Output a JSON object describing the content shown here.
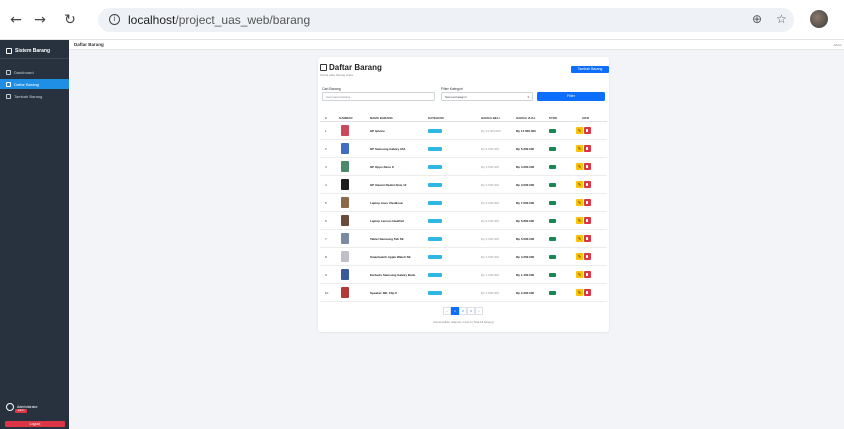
{
  "browser": {
    "url_host": "localhost",
    "url_path": "/project_uas_web/barang"
  },
  "sidebar": {
    "brand": "Sistem Barang",
    "items": [
      {
        "label": "Dashboard",
        "active": false
      },
      {
        "label": "Daftar Barang",
        "active": true
      },
      {
        "label": "Tambah Barang",
        "active": false
      }
    ],
    "user_name": "Administrator",
    "user_role": "admin",
    "logout_label": "Logout"
  },
  "topbar": {
    "title": "Daftar Barang",
    "right_text": "Admin"
  },
  "page": {
    "title": "Daftar Barang",
    "subtitle": "Kelola data barang Anda",
    "add_button": "Tambah Barang"
  },
  "filters": {
    "search_label": "Cari Barang",
    "search_placeholder": "Cari nama barang...",
    "category_label": "Filter Kategori",
    "category_value": "Semua Kategori",
    "filter_button": "Filter"
  },
  "table": {
    "columns": [
      "#",
      "GAMBAR",
      "NAMA BARANG",
      "KATEGORI",
      "HARGA BELI",
      "HARGA JUAL",
      "STOK",
      "AKSI"
    ],
    "rows": [
      {
        "no": "1",
        "name": "HP Iphone",
        "buy": "Rp 13.000.000",
        "sell": "Rp 17.000.000",
        "thumb_color": "#c94a5a"
      },
      {
        "no": "2",
        "name": "HP Samsung Galaxy A54",
        "buy": "Rp 4.500.000",
        "sell": "Rp 5.200.000",
        "thumb_color": "#3f6cc4"
      },
      {
        "no": "3",
        "name": "HP Oppo Reno 8",
        "buy": "Rp 3.500.000",
        "sell": "Rp 4.200.000",
        "thumb_color": "#4a8a6a"
      },
      {
        "no": "4",
        "name": "HP Xiaomi Redmi Note 12",
        "buy": "Rp 2.500.000",
        "sell": "Rp 3.000.000",
        "thumb_color": "#1e1e1e"
      },
      {
        "no": "5",
        "name": "Laptop Asus VivoBook",
        "buy": "Rp 6.000.000",
        "sell": "Rp 7.000.000",
        "thumb_color": "#8a6a4a"
      },
      {
        "no": "6",
        "name": "Laptop Lenovo IdeaPad",
        "buy": "Rp 5.000.000",
        "sell": "Rp 5.800.000",
        "thumb_color": "#6a4a3a"
      },
      {
        "no": "7",
        "name": "Tablet Samsung Tab S9",
        "buy": "Rp 4.000.000",
        "sell": "Rp 5.000.000",
        "thumb_color": "#7a8aa0"
      },
      {
        "no": "8",
        "name": "Smartwatch Apple Watch SE",
        "buy": "Rp 3.500.000",
        "sell": "Rp 4.200.000",
        "thumb_color": "#c0c0c8"
      },
      {
        "no": "9",
        "name": "Earbuds Samsung Galaxy Buds",
        "buy": "Rp 1.000.000",
        "sell": "Rp 1.400.000",
        "thumb_color": "#3a5a9a"
      },
      {
        "no": "10",
        "name": "Speaker JBL Flip 6",
        "buy": "Rp 1.800.000",
        "sell": "Rp 2.300.000",
        "thumb_color": "#b03a3a"
      }
    ]
  },
  "pagination": {
    "prev": "‹",
    "pages": [
      "1",
      "2",
      "3"
    ],
    "next": "›",
    "active_page": "1",
    "info": "Menampilkan halaman 1 dari 2 (Total 18 barang)"
  },
  "colors": {
    "sidebar_bg": "#27323e",
    "primary": "#0d6efd",
    "success": "#198754",
    "warning": "#ffc107",
    "danger": "#dc3545",
    "info": "#2fb8e6"
  },
  "icons": [
    "back-arrow-icon",
    "forward-arrow-icon",
    "reload-icon",
    "site-info-icon",
    "zoom-icon",
    "star-icon",
    "box-icon",
    "pencil-icon",
    "trash-icon",
    "user-circle-icon"
  ]
}
